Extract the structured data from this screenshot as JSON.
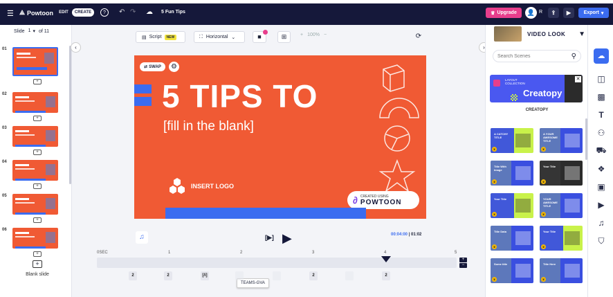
{
  "app": {
    "name": "Powtoon",
    "title": "5 Fun Tips",
    "mode_edit": "EDIT",
    "mode_create": "CREATE",
    "upgrade": "Upgrade",
    "avatar_initial": "R",
    "export": "Export"
  },
  "slides_panel": {
    "label": "Slide",
    "current": "1",
    "total": "of 11",
    "numbers": [
      "01",
      "02",
      "03",
      "04",
      "05",
      "06"
    ],
    "blank_label": "Blank slide"
  },
  "toolbar": {
    "script": "Script",
    "new_badge": "NEW",
    "orientation": "Horizontal",
    "zoom": "100%"
  },
  "slide": {
    "swap": "SWAP",
    "title": "5 TIPS TO",
    "subtitle": "[fill in the blank]",
    "logo": "INSERT LOGO",
    "created_using": "CREATED USING",
    "brand": "POWTOON"
  },
  "playback": {
    "current_time": "00:04:00",
    "total_time": "01:02",
    "frame_label": "[▶]"
  },
  "timeline": {
    "ticks": [
      "0SEC",
      "1",
      "2",
      "3",
      "4",
      "5"
    ],
    "keyframes": [
      "2",
      "2",
      "[/i]",
      "2",
      "2",
      "2"
    ],
    "tooltip": "TEAMS-GVA"
  },
  "scenes_panel": {
    "section": "VIDEO LOOK",
    "search_placeholder": "Search Scenes",
    "layout_label": "LAYOUT COLLECTION",
    "collection_name": "Creatopy",
    "collection_caption": "CREATOPY",
    "thumbs": [
      {
        "bg": "#c9f24a",
        "text": "A CATCHY TITLE"
      },
      {
        "bg": "#3a4fe0",
        "text": "A YOUR AWESOME TITLE"
      },
      {
        "bg": "#3a4fe0",
        "text": "Title With Image"
      },
      {
        "bg": "#2b2b2b",
        "text": "Your Title"
      },
      {
        "bg": "#c9f24a",
        "text": "Your Title"
      },
      {
        "bg": "#3a4fe0",
        "text": "YOUR AWESOME TITLE"
      },
      {
        "bg": "#3a4fe0",
        "text": "Title Data"
      },
      {
        "bg": "#c9f24a",
        "text": "Your Title"
      },
      {
        "bg": "#3a4fe0",
        "text": "Some title"
      },
      {
        "bg": "#3a4fe0",
        "text": "Title Here"
      }
    ]
  },
  "colors": {
    "topbar": "#15183a",
    "accent_orange": "#f05a34",
    "accent_blue": "#3b6cf0",
    "upgrade": "#e83e8c"
  }
}
